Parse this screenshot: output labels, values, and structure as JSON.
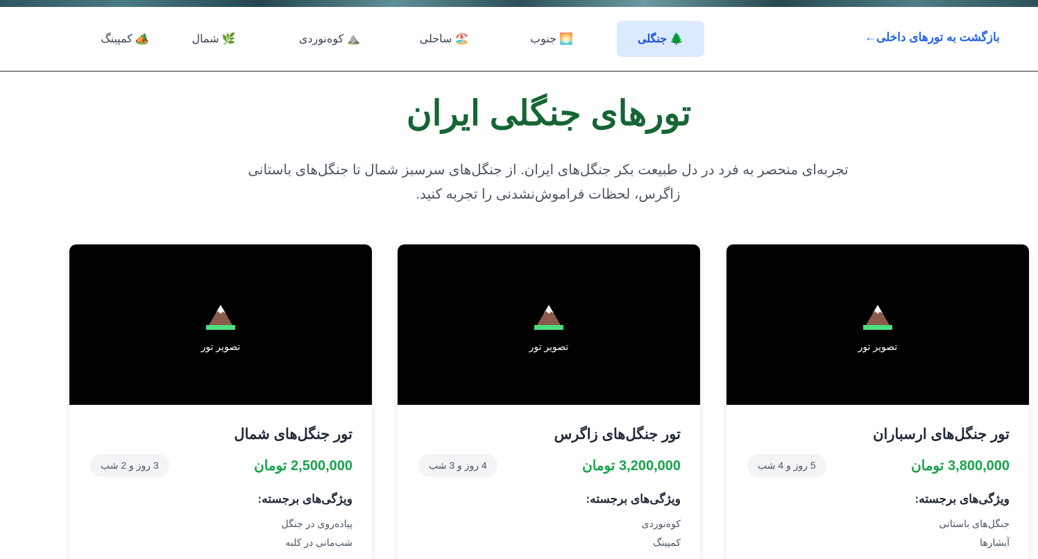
{
  "nav": {
    "back_label": "بازگشت به تورهای داخلی",
    "back_arrow": "←",
    "items": [
      {
        "icon": "🌲",
        "label": "جنگلی",
        "active": true
      },
      {
        "icon": "🌅",
        "label": "جنوب",
        "active": false
      },
      {
        "icon": "🏖️",
        "label": "ساحلی",
        "active": false
      },
      {
        "icon": "⛰️",
        "label": "کوه‌نوردی",
        "active": false
      },
      {
        "icon": "🌿",
        "label": "شمال",
        "active": false
      },
      {
        "icon": "🏕️",
        "label": "کمپینگ",
        "active": false
      }
    ]
  },
  "hero": {
    "title": "تورهای جنگلی ایران",
    "description": "تجربه‌ای منحصر به فرد در دل طبیعت بکر جنگل‌های ایران. از جنگل‌های سرسبز شمال تا جنگل‌های باستانی زاگرس، لحظات فراموش‌نشدنی را تجربه کنید."
  },
  "cards": [
    {
      "image_label": "تصویر تور",
      "image_icon": "mountain-icon",
      "title": "تور جنگل‌های ارسباران",
      "price": "3,800,000 تومان",
      "duration": "5 روز و 4 شب",
      "features_heading": "ویژگی‌های برجسته:",
      "features": [
        "جنگل‌های باستانی",
        "آبشارها"
      ]
    },
    {
      "image_label": "تصویر تور",
      "image_icon": "mountain-icon",
      "title": "تور جنگل‌های زاگرس",
      "price": "3,200,000 تومان",
      "duration": "4 روز و 3 شب",
      "features_heading": "ویژگی‌های برجسته:",
      "features": [
        "کوه‌نوردی",
        "کمپینگ"
      ]
    },
    {
      "image_label": "تصویر تور",
      "image_icon": "mountain-icon",
      "title": "تور جنگل‌های شمال",
      "price": "2,500,000 تومان",
      "duration": "3 روز و 2 شب",
      "features_heading": "ویژگی‌های برجسته:",
      "features": [
        "پیاده‌روی در جنگل",
        "شب‌مانی در کلبه"
      ]
    }
  ],
  "colors": {
    "title_green": "#166534",
    "price_green": "#16a34a",
    "link_blue": "#2563eb",
    "active_tab_bg": "#dbeafe"
  }
}
